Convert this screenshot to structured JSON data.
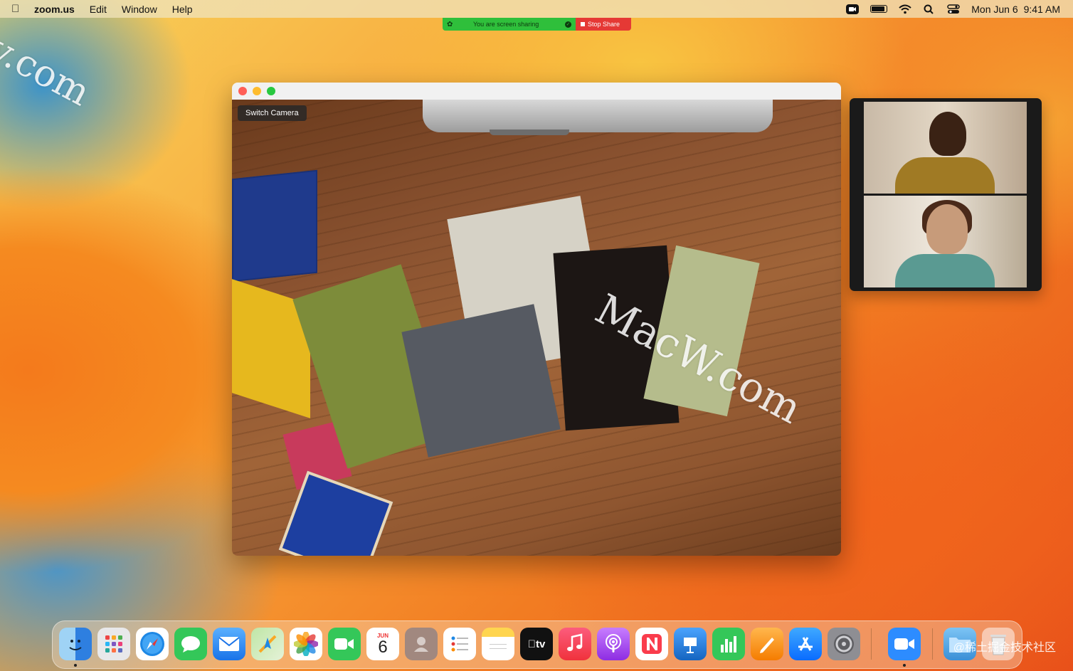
{
  "menubar": {
    "app_name": "zoom.us",
    "menus": [
      "Edit",
      "Window",
      "Help"
    ],
    "date": "Mon Jun 6",
    "time": "9:41 AM"
  },
  "sharing_banner": {
    "status": "You are screen sharing",
    "stop_label": "Stop Share",
    "green": "#2fbf3b",
    "red": "#e53935"
  },
  "watermark": {
    "top_left": "v.com",
    "center": "MacW.com",
    "bottom_right": "@稀土掘金技术社区"
  },
  "video_window": {
    "switch_camera_label": "Switch Camera"
  },
  "dock": {
    "calendar_month": "JUN",
    "calendar_day": "6",
    "tv_label": "tv",
    "items": [
      "finder-icon",
      "launchpad-icon",
      "safari-icon",
      "messages-icon",
      "mail-icon",
      "maps-icon",
      "photos-icon",
      "facetime-icon",
      "calendar-icon",
      "contacts-icon",
      "reminders-icon",
      "notes-icon",
      "apple-tv-icon",
      "music-icon",
      "podcasts-icon",
      "news-icon",
      "keynote-icon",
      "numbers-icon",
      "pages-icon",
      "app-store-icon",
      "system-settings-icon",
      "zoom-icon",
      "downloads-folder-icon",
      "trash-icon"
    ]
  }
}
